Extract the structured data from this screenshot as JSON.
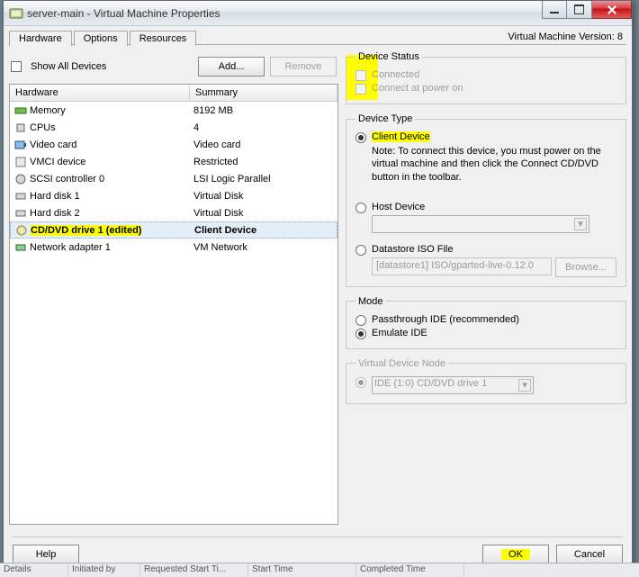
{
  "window": {
    "title": "server-main - Virtual Machine Properties"
  },
  "tabs": {
    "hardware": "Hardware",
    "options": "Options",
    "resources": "Resources"
  },
  "version_label": "Virtual Machine Version: 8",
  "left": {
    "show_all": "Show All Devices",
    "add": "Add...",
    "remove": "Remove"
  },
  "columns": {
    "hw": "Hardware",
    "summary": "Summary"
  },
  "rows": [
    {
      "icon": "memory",
      "name": "Memory",
      "summary": "8192 MB"
    },
    {
      "icon": "cpu",
      "name": "CPUs",
      "summary": "4"
    },
    {
      "icon": "video",
      "name": "Video card",
      "summary": "Video card"
    },
    {
      "icon": "vmci",
      "name": "VMCI device",
      "summary": "Restricted"
    },
    {
      "icon": "scsi",
      "name": "SCSI controller 0",
      "summary": "LSI Logic Parallel"
    },
    {
      "icon": "disk",
      "name": "Hard disk 1",
      "summary": "Virtual Disk"
    },
    {
      "icon": "disk",
      "name": "Hard disk 2",
      "summary": "Virtual Disk"
    },
    {
      "icon": "cd",
      "name": "CD/DVD drive 1 (edited)",
      "summary": "Client Device"
    },
    {
      "icon": "nic",
      "name": "Network adapter 1",
      "summary": "VM Network"
    }
  ],
  "device_status": {
    "legend": "Device Status",
    "connected": "Connected",
    "poweron": "Connect at power on"
  },
  "device_type": {
    "legend": "Device Type",
    "client": "Client Device",
    "note": "Note: To connect this device, you must power on the virtual machine and then click the Connect CD/DVD button in the toolbar.",
    "host": "Host Device",
    "host_sel": "",
    "iso": "Datastore ISO File",
    "iso_path": "[datastore1] ISO/gparted-live-0.12.0",
    "browse": "Browse..."
  },
  "mode": {
    "legend": "Mode",
    "pass": "Passthrough IDE (recommended)",
    "emu": "Emulate IDE"
  },
  "vdn": {
    "legend": "Virtual Device Node",
    "value": "IDE (1:0) CD/DVD drive 1"
  },
  "buttons": {
    "help": "Help",
    "ok": "OK",
    "cancel": "Cancel"
  },
  "statusbar": {
    "details": "Details",
    "initiated": "Initiated by",
    "reqstart": "Requested Start Ti...",
    "start": "Start Time",
    "complete": "Completed Time"
  }
}
